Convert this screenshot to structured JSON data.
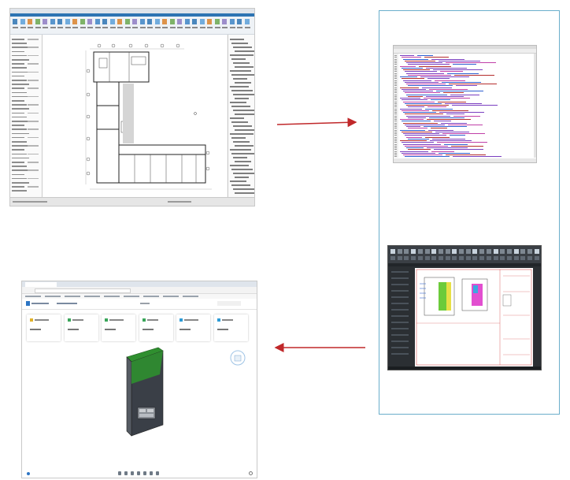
{
  "diagram": {
    "title": "",
    "colors": {
      "frame_border": "#6aaecb",
      "arrow": "#c0282a",
      "revit_ribbon": "#2d74b3",
      "webapp_header": "#2d75c4",
      "building_green": "#2f8f2f",
      "cad_background": "#2b2f33"
    },
    "panels": {
      "revit": {
        "kind": "BIM authoring application screenshot",
        "icon": "floor-plan",
        "text": ""
      },
      "xml": {
        "kind": "exported data file screenshot",
        "icon": "code-lines",
        "text": ""
      },
      "cad": {
        "kind": "CAD drawing screenshot",
        "icon": "drawing-sheet",
        "text": ""
      },
      "web": {
        "kind": "web viewer screenshot",
        "icon": "3d-model",
        "text": ""
      }
    },
    "arrows": [
      {
        "from": "revit",
        "to": "frame",
        "direction": "right"
      },
      {
        "from": "frame",
        "to": "web",
        "direction": "left"
      }
    ]
  }
}
